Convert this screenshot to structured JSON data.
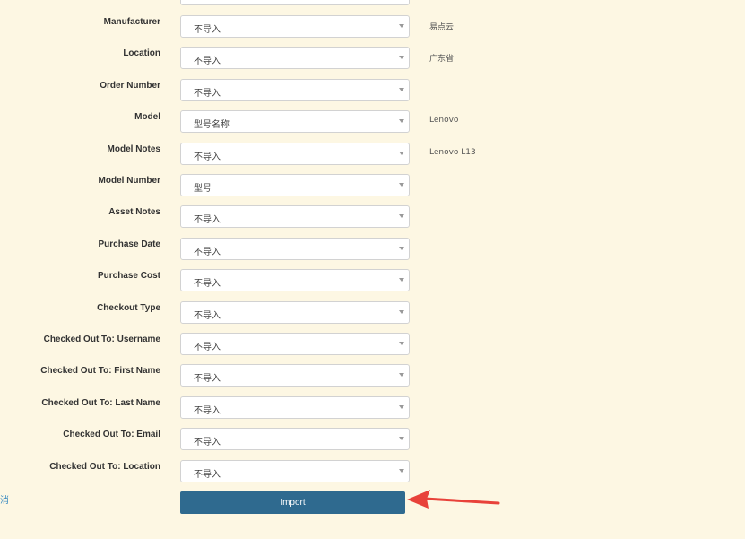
{
  "fields": [
    {
      "label": "Manufacturer",
      "value": "不导入",
      "sample": "易点云"
    },
    {
      "label": "Location",
      "value": "不导入",
      "sample": "广东省"
    },
    {
      "label": "Order Number",
      "value": "不导入",
      "sample": ""
    },
    {
      "label": "Model",
      "value": "型号名称",
      "sample": "Lenovo"
    },
    {
      "label": "Model Notes",
      "value": "不导入",
      "sample": "Lenovo L13"
    },
    {
      "label": "Model Number",
      "value": "型号",
      "sample": ""
    },
    {
      "label": "Asset Notes",
      "value": "不导入",
      "sample": ""
    },
    {
      "label": "Purchase Date",
      "value": "不导入",
      "sample": ""
    },
    {
      "label": "Purchase Cost",
      "value": "不导入",
      "sample": ""
    },
    {
      "label": "Checkout Type",
      "value": "不导入",
      "sample": ""
    },
    {
      "label": "Checked Out To: Username",
      "value": "不导入",
      "sample": ""
    },
    {
      "label": "Checked Out To: First Name",
      "value": "不导入",
      "sample": ""
    },
    {
      "label": "Checked Out To: Last Name",
      "value": "不导入",
      "sample": ""
    },
    {
      "label": "Checked Out To: Email",
      "value": "不导入",
      "sample": ""
    },
    {
      "label": "Checked Out To: Location",
      "value": "不导入",
      "sample": ""
    }
  ],
  "left_edge_text": "消",
  "import_label": "Import",
  "colors": {
    "background": "#fdf7e3",
    "button": "#2f6a8f",
    "arrow": "#e8423a",
    "link": "#3a8bc0"
  },
  "icons": {
    "caret": "caret-down-icon",
    "annotation": "red-arrow-icon"
  }
}
